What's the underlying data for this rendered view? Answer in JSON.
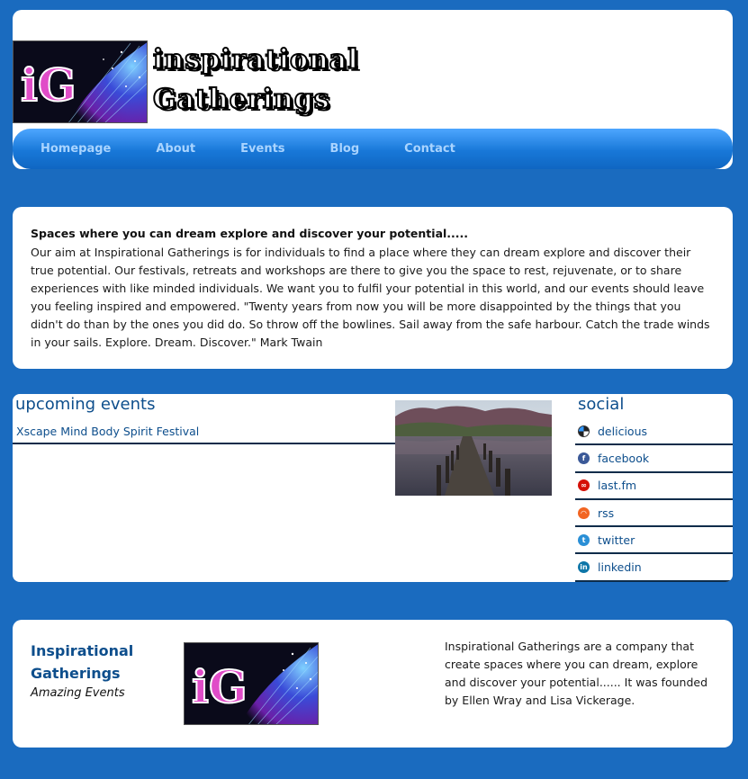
{
  "site": {
    "logo_text_line1": "inspirational",
    "logo_text_line2": "Gatherings",
    "logo_mark": "iG"
  },
  "nav": {
    "items": [
      "Homepage",
      "About",
      "Events",
      "Blog",
      "Contact"
    ]
  },
  "intro": {
    "heading": "Spaces where you can dream explore and discover your potential.....",
    "body": "Our aim at Inspirational Gatherings is for individuals to find a place where they can dream explore and discover their true potential. Our festivals, retreats and workshops are there to give you the space to rest, rejuvenate, or to share experiences with like minded individuals. We want you to fulfil your potential in this world, and our events should leave you feeling inspired and empowered. \"Twenty years from now you will be more disappointed by the things that you didn't do than by the ones you did do. So throw off the bowlines. Sail away from the safe harbour. Catch the trade winds in your sails. Explore. Dream. Discover.\" Mark Twain"
  },
  "events": {
    "heading": "upcoming events",
    "items": [
      "Xscape Mind Body Spirit Festival"
    ]
  },
  "social": {
    "heading": "social",
    "items": [
      {
        "label": "delicious",
        "icon": "delicious-icon",
        "color": "#222222"
      },
      {
        "label": "facebook",
        "icon": "facebook-icon",
        "color": "#3b5998"
      },
      {
        "label": "last.fm",
        "icon": "lastfm-icon",
        "color": "#d51007"
      },
      {
        "label": "rss",
        "icon": "rss-icon",
        "color": "#f26522"
      },
      {
        "label": "twitter",
        "icon": "twitter-icon",
        "color": "#2a8fd6"
      },
      {
        "label": "linkedin",
        "icon": "linkedin-icon",
        "color": "#0e76a8"
      }
    ]
  },
  "footer": {
    "company_name": "Inspirational Gatherings",
    "tagline": "Amazing Events",
    "about": "Inspirational Gatherings are a company that create spaces where you can dream, explore and discover your potential...... It was founded by Ellen Wray and Lisa Vickerage."
  },
  "colors": {
    "background": "#1a6bbf",
    "accent": "#0d4e8c",
    "nav_text": "#a9d4ff"
  }
}
